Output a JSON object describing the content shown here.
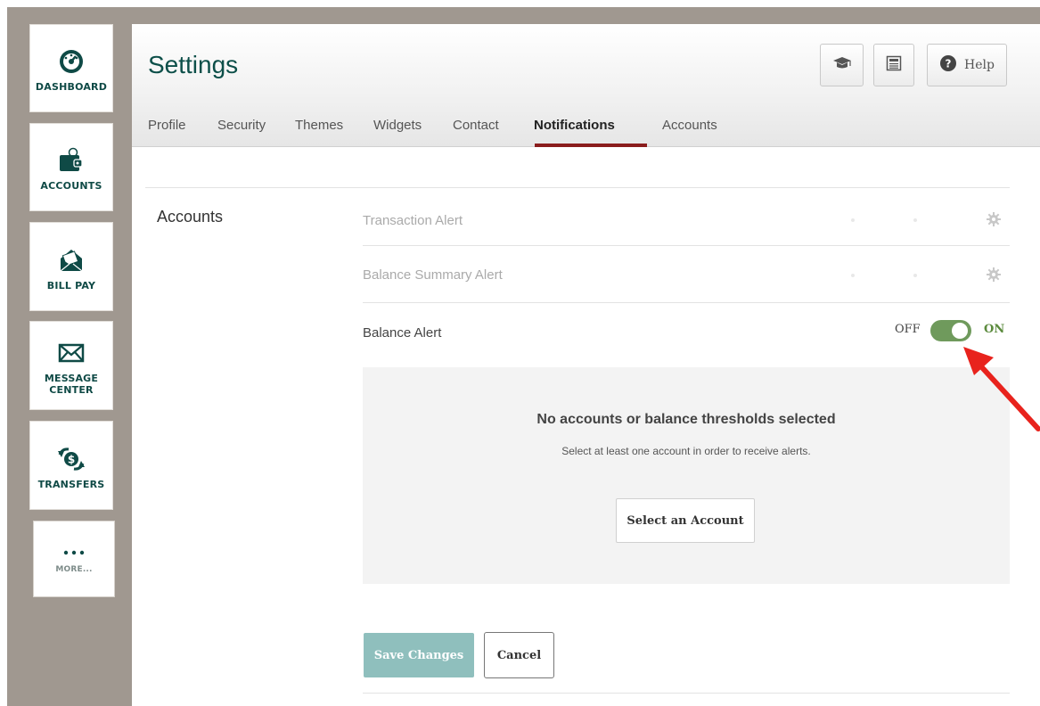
{
  "sidebar": {
    "items": [
      {
        "label": "DASHBOARD",
        "icon": "dashboard-gauge-icon"
      },
      {
        "label": "ACCOUNTS",
        "icon": "wallet-icon"
      },
      {
        "label": "BILL PAY",
        "icon": "envelope-open-icon"
      },
      {
        "label": "MESSAGE CENTER",
        "icon": "envelope-icon"
      },
      {
        "label": "TRANSFERS",
        "icon": "transfer-dollar-icon"
      },
      {
        "label": "MORE...",
        "icon": "more-dots-icon"
      }
    ]
  },
  "header": {
    "title": "Settings",
    "help_label": "Help",
    "icons": [
      "graduation-cap-icon",
      "newspaper-icon",
      "help-circle-icon"
    ]
  },
  "tabs": [
    {
      "label": "Profile",
      "active": false
    },
    {
      "label": "Security",
      "active": false
    },
    {
      "label": "Themes",
      "active": false
    },
    {
      "label": "Widgets",
      "active": false
    },
    {
      "label": "Contact",
      "active": false
    },
    {
      "label": "Notifications",
      "active": true
    },
    {
      "label": "Accounts",
      "active": false
    }
  ],
  "section": {
    "label": "Accounts",
    "alerts": [
      {
        "label": "Transaction Alert",
        "enabled": false
      },
      {
        "label": "Balance Summary Alert",
        "enabled": false
      },
      {
        "label": "Balance Alert",
        "enabled": true
      }
    ]
  },
  "toggle": {
    "off_label": "OFF",
    "on_label": "ON",
    "state": "on"
  },
  "empty_state": {
    "title": "No accounts or balance thresholds selected",
    "subtitle": "Select at least one account in order to receive alerts.",
    "button": "Select an Account"
  },
  "actions": {
    "save": "Save Changes",
    "cancel": "Cancel"
  },
  "colors": {
    "brand": "#0d4f49",
    "tab_active_underline": "#8a1c1c",
    "toggle_on": "#6f9a5c",
    "save_button": "#8fbfbd",
    "annotation_arrow": "#e8231d",
    "frame": "#a09890"
  }
}
